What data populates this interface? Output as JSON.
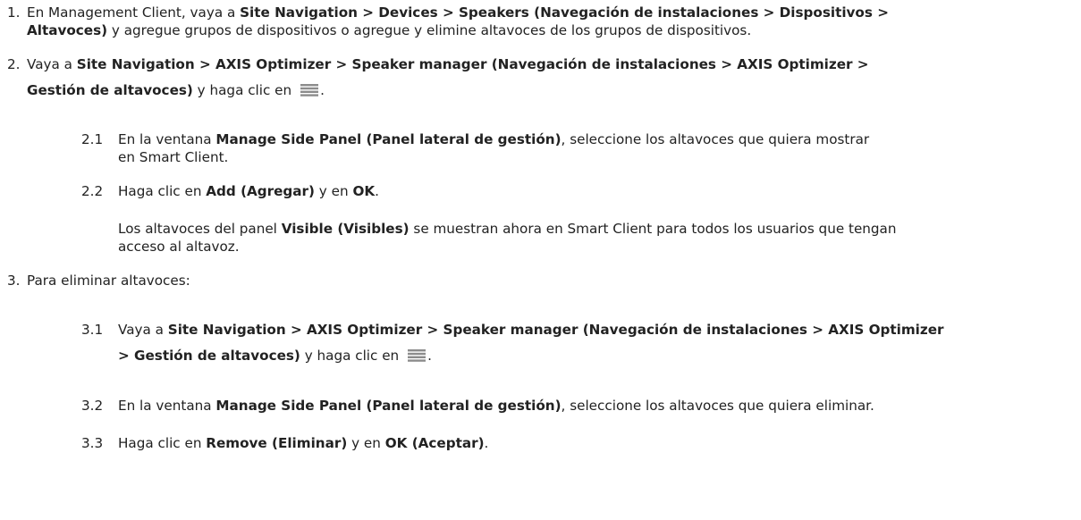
{
  "steps": [
    {
      "number": "1.",
      "lines": [
        [
          "En Management Client, vaya a ",
          "Site Navigation > Devices > Speakers (Navegación de instalaciones > Dispositivos >"
        ],
        [
          "Altavoces)",
          " y agregue grupos de dispositivos o agregue y elimine altavoces de los grupos de dispositivos."
        ]
      ]
    },
    {
      "number": "2.",
      "lines": [
        [
          "Vaya a ",
          "Site Navigation > AXIS Optimizer > Speaker manager (Navegación de instalaciones > AXIS Optimizer >"
        ],
        [
          "Gestión de altavoces)",
          " y haga clic en",
          "."
        ]
      ],
      "substeps": [
        {
          "number": "2.1",
          "lines": [
            [
              "En la ventana ",
              "Manage Side Panel (Panel lateral de gestión)",
              ", seleccione los altavoces que quiera mostrar"
            ],
            [
              "en Smart Client."
            ]
          ]
        },
        {
          "number": "2.2",
          "lines": [
            [
              "Haga clic en ",
              "Add (Agregar)",
              " y en ",
              "OK",
              "."
            ]
          ],
          "note": [
            [
              "Los altavoces del panel ",
              "Visible (Visibles)",
              " se muestran ahora en Smart Client para todos los usuarios que tengan"
            ],
            [
              "acceso al altavoz."
            ]
          ]
        }
      ]
    },
    {
      "number": "3.",
      "lines": [
        [
          "Para eliminar altavoces:"
        ]
      ],
      "substeps": [
        {
          "number": "3.1",
          "lines": [
            [
              "Vaya a ",
              "Site Navigation > AXIS Optimizer > Speaker manager (Navegación de instalaciones > AXIS Optimizer"
            ],
            [
              "> Gestión de altavoces)",
              " y haga clic en",
              "."
            ]
          ]
        },
        {
          "number": "3.2",
          "lines": [
            [
              "En la ventana ",
              "Manage Side Panel (Panel lateral de gestión)",
              ", seleccione los altavoces que quiera eliminar."
            ]
          ]
        },
        {
          "number": "3.3",
          "lines": [
            [
              "Haga clic en ",
              "Remove (Eliminar)",
              " y en ",
              "OK (Aceptar)",
              "."
            ]
          ]
        }
      ]
    }
  ],
  "icons": {
    "list_icon": "list-menu-icon",
    "icon_color": "#8c8c8c"
  }
}
